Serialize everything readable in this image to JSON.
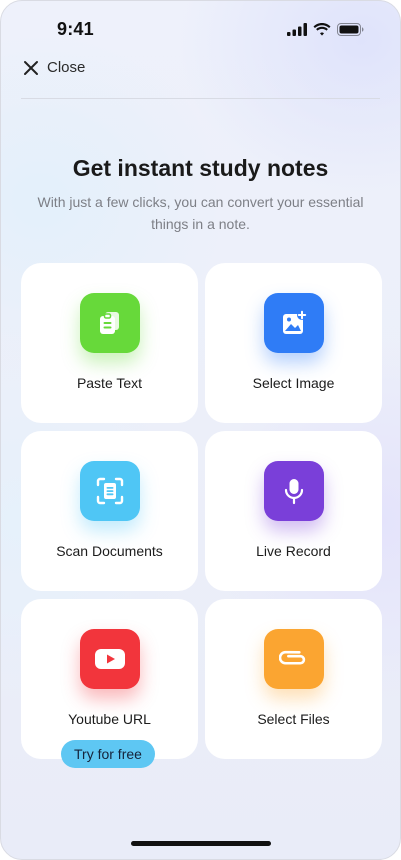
{
  "status_bar": {
    "time": "9:41"
  },
  "header": {
    "close_label": "Close"
  },
  "main": {
    "title": "Get instant study notes",
    "subtitle": "With just a few clicks, you can convert your essential things in a note."
  },
  "options": [
    {
      "label": "Paste Text",
      "icon": "paste-icon",
      "color": "#67d93a"
    },
    {
      "label": "Select Image",
      "icon": "add-image-icon",
      "color": "#2f7cf6"
    },
    {
      "label": "Scan Documents",
      "icon": "scan-document-icon",
      "color": "#4fc6f5"
    },
    {
      "label": "Live Record",
      "icon": "microphone-icon",
      "color": "#7a3fd9"
    },
    {
      "label": "Youtube URL",
      "icon": "youtube-icon",
      "color": "#f2353c",
      "badge": "Try for free"
    },
    {
      "label": "Select Files",
      "icon": "paperclip-icon",
      "color": "#fba531"
    }
  ],
  "colors": {
    "badge": "#5ec7f3",
    "card_background": "#ffffff",
    "subtitle_text": "#7d7f86"
  }
}
